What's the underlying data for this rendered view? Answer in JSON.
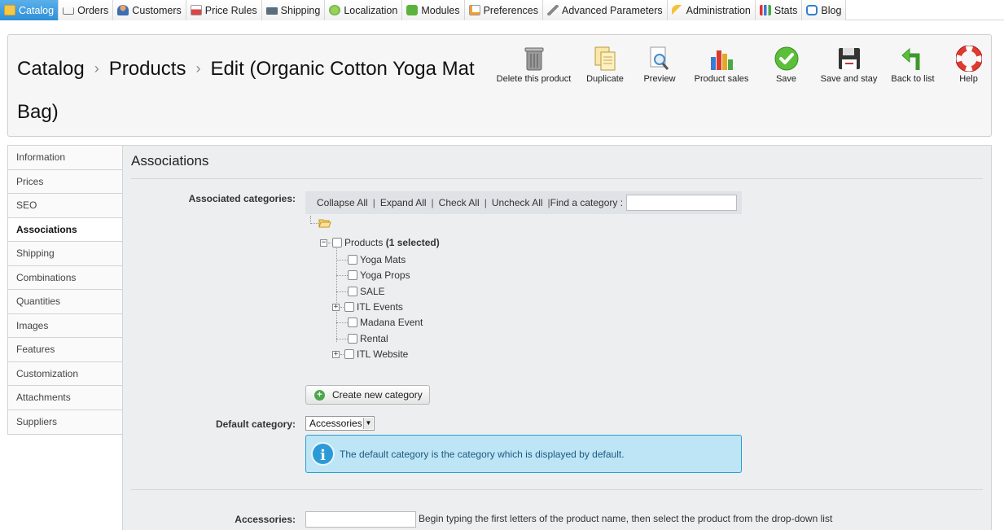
{
  "topnav": [
    {
      "label": "Catalog",
      "icon": "catalog-icon",
      "active": true
    },
    {
      "label": "Orders",
      "icon": "cart-icon"
    },
    {
      "label": "Customers",
      "icon": "customers-icon"
    },
    {
      "label": "Price Rules",
      "icon": "price-rules-icon"
    },
    {
      "label": "Shipping",
      "icon": "truck-icon"
    },
    {
      "label": "Localization",
      "icon": "globe-icon"
    },
    {
      "label": "Modules",
      "icon": "puzzle-icon"
    },
    {
      "label": "Preferences",
      "icon": "preferences-icon"
    },
    {
      "label": "Advanced Parameters",
      "icon": "wrench-icon"
    },
    {
      "label": "Administration",
      "icon": "key-icon"
    },
    {
      "label": "Stats",
      "icon": "stats-icon"
    },
    {
      "label": "Blog",
      "icon": "speech-bubble-icon"
    }
  ],
  "breadcrumb": {
    "catalog": "Catalog",
    "products": "Products",
    "edit": "Edit (Organic Cotton Yoga Mat Bag)",
    "separator": "›"
  },
  "toolbar": {
    "delete": "Delete this product",
    "duplicate": "Duplicate",
    "preview": "Preview",
    "product_sales": "Product sales",
    "save": "Save",
    "save_and_stay": "Save and stay",
    "back_to_list": "Back to list",
    "help": "Help"
  },
  "left_tabs": [
    {
      "label": "Information"
    },
    {
      "label": "Prices"
    },
    {
      "label": "SEO"
    },
    {
      "label": "Associations",
      "active": true
    },
    {
      "label": "Shipping"
    },
    {
      "label": "Combinations"
    },
    {
      "label": "Quantities"
    },
    {
      "label": "Images"
    },
    {
      "label": "Features"
    },
    {
      "label": "Customization"
    },
    {
      "label": "Attachments"
    },
    {
      "label": "Suppliers"
    }
  ],
  "panel": {
    "title": "Associations",
    "associated_categories_label": "Associated categories:",
    "tree_actions": {
      "collapse_all": "Collapse All",
      "expand_all": "Expand All",
      "check_all": "Check All",
      "uncheck_all": "Uncheck All",
      "find_category": "Find a category :",
      "pipe": "|"
    },
    "tree_root": {
      "label": "Products",
      "selected_text": "(1 selected)"
    },
    "tree_children": [
      {
        "label": "Yoga Mats",
        "expandable": false
      },
      {
        "label": "Yoga Props",
        "expandable": false
      },
      {
        "label": "SALE",
        "expandable": false
      },
      {
        "label": "ITL Events",
        "expandable": true
      },
      {
        "label": "Madana Event",
        "expandable": false
      },
      {
        "label": "Rental",
        "expandable": false
      },
      {
        "label": "ITL Website",
        "expandable": true
      }
    ],
    "create_new_category": "Create new category",
    "default_category_label": "Default category:",
    "default_category_value": "Accessories",
    "info_text": "The default category is the category which is displayed by default.",
    "accessories_label": "Accessories:",
    "accessories_hint": "Begin typing the first letters of the product name, then select the product from the drop-down list"
  },
  "colors": {
    "active_tab": "#2f8fd8",
    "info_bg": "#bde5f5",
    "info_border": "#2a9ed0"
  }
}
